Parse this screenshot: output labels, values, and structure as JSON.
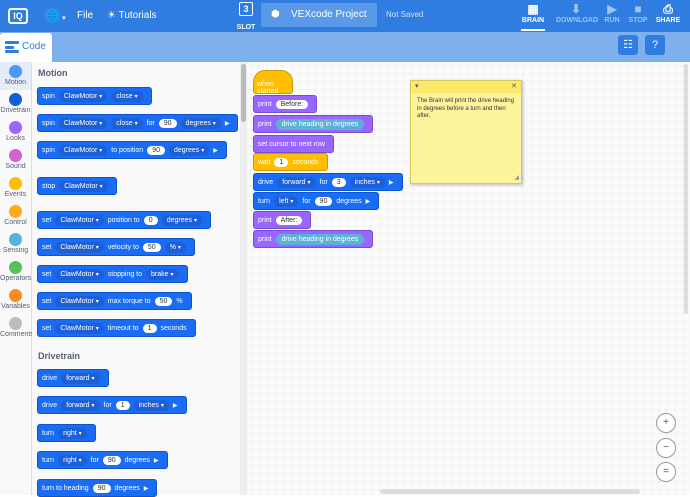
{
  "topbar": {
    "logo": "IQ",
    "file": "File",
    "tutorials": "Tutorials",
    "slot_num": "3",
    "slot_label": "SLOT",
    "project_name": "VEXcode Project",
    "save_status": "Not Saved",
    "brain": "BRAIN",
    "download": "DOWNLOAD",
    "run": "RUN",
    "stop": "STOP",
    "share": "SHARE",
    "colors": {
      "bar": "#2f7de1",
      "tabbar": "#7fb0ee"
    }
  },
  "tab": {
    "code": "Code"
  },
  "categories": [
    {
      "label": "Motion",
      "color": "#4c97ff"
    },
    {
      "label": "Drivetrain",
      "color": "#0e5fd8"
    },
    {
      "label": "Looks",
      "color": "#9966ff"
    },
    {
      "label": "Sound",
      "color": "#cf63cf"
    },
    {
      "label": "Events",
      "color": "#ffbf00"
    },
    {
      "label": "Control",
      "color": "#ffab19"
    },
    {
      "label": "Sensing",
      "color": "#5cb1d6"
    },
    {
      "label": "Operators",
      "color": "#59c059"
    },
    {
      "label": "Variables",
      "color": "#ff8c1a"
    },
    {
      "label": "Comments",
      "color": "#bdbdbd"
    }
  ],
  "palette": {
    "motion_header": "Motion",
    "drivetrain_header": "Drivetrain",
    "motion": {
      "spin": "spin",
      "stop": "stop",
      "set": "set",
      "motor": "ClawMotor",
      "close": "close",
      "for": "for",
      "degrees": "degrees",
      "to_position": "to position",
      "position_to": "position to",
      "velocity_to": "velocity to",
      "percent": "%",
      "stopping_to": "stopping to",
      "brake": "brake",
      "max_torque_to": "max torque to",
      "timeout_to": "timeout to",
      "seconds": "seconds",
      "v90": "90",
      "v0": "0",
      "v50": "50",
      "v1": "1"
    },
    "drivetrain": {
      "drive": "drive",
      "forward": "forward",
      "for": "for",
      "inches": "inches",
      "turn": "turn",
      "right": "right",
      "degrees": "degrees",
      "turn_to_heading": "turn to heading",
      "v1": "1",
      "v90": "90"
    }
  },
  "script": {
    "when_started": "when started",
    "print": "print",
    "before": "Before:",
    "drive_heading": "drive heading in degrees",
    "set_cursor": "set cursor to next row",
    "wait": "wait",
    "wait_val": "1",
    "seconds": "seconds",
    "drive": "drive",
    "forward": "forward",
    "for": "for",
    "drive_val": "3",
    "inches": "inches",
    "turn": "turn",
    "left": "left",
    "turn_val": "90",
    "degrees": "degrees",
    "after": "After:"
  },
  "note": {
    "text": "The Brain will print the drive heading in degrees before a turn and then after.",
    "close": "✕"
  }
}
